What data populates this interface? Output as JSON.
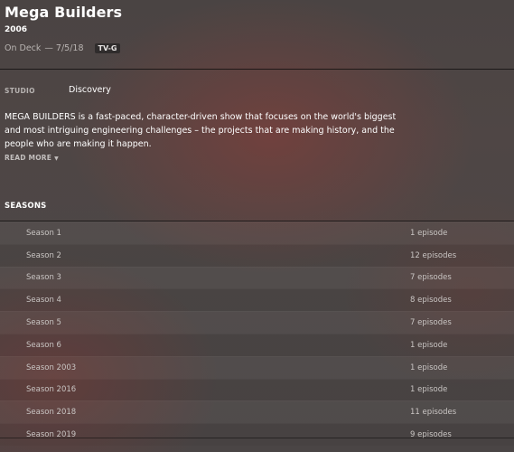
{
  "show": {
    "title": "Mega Builders",
    "year": "2006",
    "on_deck_label": "On Deck",
    "date": "— 7/5/18",
    "rating": "TV-G"
  },
  "details": {
    "studio_label": "STUDIO",
    "studio_value": "Discovery",
    "summary": "MEGA BUILDERS is a fast-paced, character-driven show that focuses on the world's biggest and most intriguing engineering challenges – the projects that are making history, and the people who are making it happen.",
    "read_more": "READ MORE",
    "read_more_icon": "caret-down-icon"
  },
  "seasons": {
    "heading": "SEASONS",
    "items": [
      {
        "name": "Season 1",
        "episodes": "1 episode"
      },
      {
        "name": "Season 2",
        "episodes": "12 episodes"
      },
      {
        "name": "Season 3",
        "episodes": "7 episodes"
      },
      {
        "name": "Season 4",
        "episodes": "8 episodes"
      },
      {
        "name": "Season 5",
        "episodes": "7 episodes"
      },
      {
        "name": "Season 6",
        "episodes": "1 episode"
      },
      {
        "name": "Season 2003",
        "episodes": "1 episode"
      },
      {
        "name": "Season 2016",
        "episodes": "1 episode"
      },
      {
        "name": "Season 2018",
        "episodes": "11 episodes"
      },
      {
        "name": "Season 2019",
        "episodes": "9 episodes"
      }
    ]
  }
}
